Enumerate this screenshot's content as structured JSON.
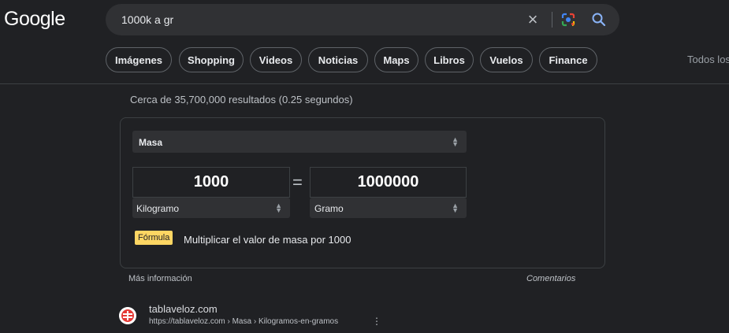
{
  "logo": "Google",
  "search": {
    "query": "1000k a gr"
  },
  "chips": [
    "Imágenes",
    "Shopping",
    "Videos",
    "Noticias",
    "Maps",
    "Libros",
    "Vuelos",
    "Finance"
  ],
  "tools_label": "Todos los",
  "stats": "Cerca de 35,700,000 resultados (0.25 segundos)",
  "converter": {
    "category": "Masa",
    "from_value": "1000",
    "from_unit": "Kilogramo",
    "to_value": "1000000",
    "to_unit": "Gramo",
    "equals": "=",
    "formula_badge": "Fórmula",
    "formula_text": "Multiplicar el valor de masa por 1000"
  },
  "footer": {
    "more_info": "Más información",
    "comments": "Comentarios"
  },
  "result": {
    "site": "tablaveloz.com",
    "url": "https://tablaveloz.com › Masa › Kilogramos-en-gramos"
  },
  "colors": {
    "background": "#202124",
    "searchbox": "#303134",
    "formula_badge": "#fdd663",
    "search_icon": "#8ab4f8"
  }
}
